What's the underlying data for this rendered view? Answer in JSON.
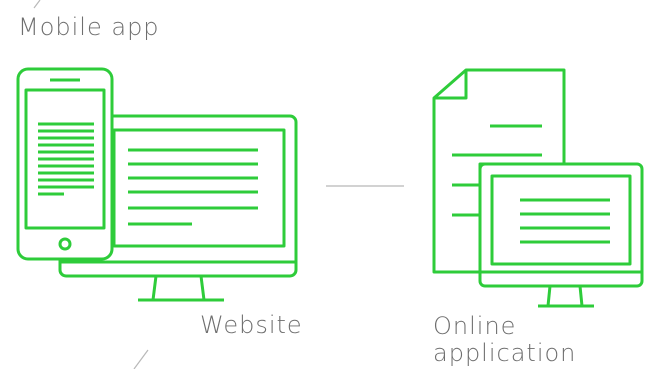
{
  "labels": {
    "mobile_app": "Mobile app",
    "website": "Website",
    "online_application": [
      "Online",
      "application"
    ]
  },
  "colors": {
    "accent": "#2ecc3a",
    "divider": "#b8b8b8",
    "text": "#6e6e6e"
  }
}
